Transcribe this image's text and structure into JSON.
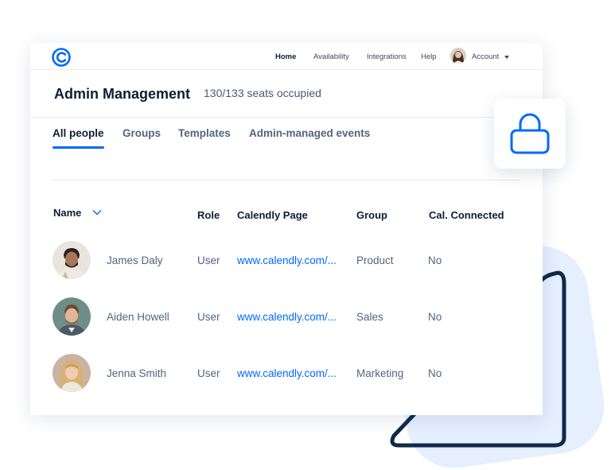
{
  "nav": {
    "home": "Home",
    "availability": "Availability",
    "integrations": "Integrations",
    "help": "Help",
    "account": "Account"
  },
  "header": {
    "title": "Admin Management",
    "seats": "130/133 seats occupied"
  },
  "tabs": [
    {
      "label": "All people",
      "active": true
    },
    {
      "label": "Groups",
      "active": false
    },
    {
      "label": "Templates",
      "active": false
    },
    {
      "label": "Admin-managed events",
      "active": false
    }
  ],
  "table": {
    "columns": [
      "Name",
      "Role",
      "Calendly Page",
      "Group",
      "Cal. Connected"
    ],
    "rows": [
      {
        "name": "James Daly",
        "role": "User",
        "page": "www.calendly.com/...",
        "group": "Product",
        "connected": "No"
      },
      {
        "name": "Aiden Howell",
        "role": "User",
        "page": "www.calendly.com/...",
        "group": "Sales",
        "connected": "No"
      },
      {
        "name": "Jenna Smith",
        "role": "User",
        "page": "www.calendly.com/...",
        "group": "Marketing",
        "connected": "No"
      }
    ]
  },
  "colors": {
    "brand_blue": "#0069ff",
    "navy": "#0b1f36",
    "decor_light": "#e4eefd"
  },
  "icons": [
    "calendly-logo-icon",
    "chevron-down-icon",
    "caret-down-icon",
    "lock-icon"
  ]
}
